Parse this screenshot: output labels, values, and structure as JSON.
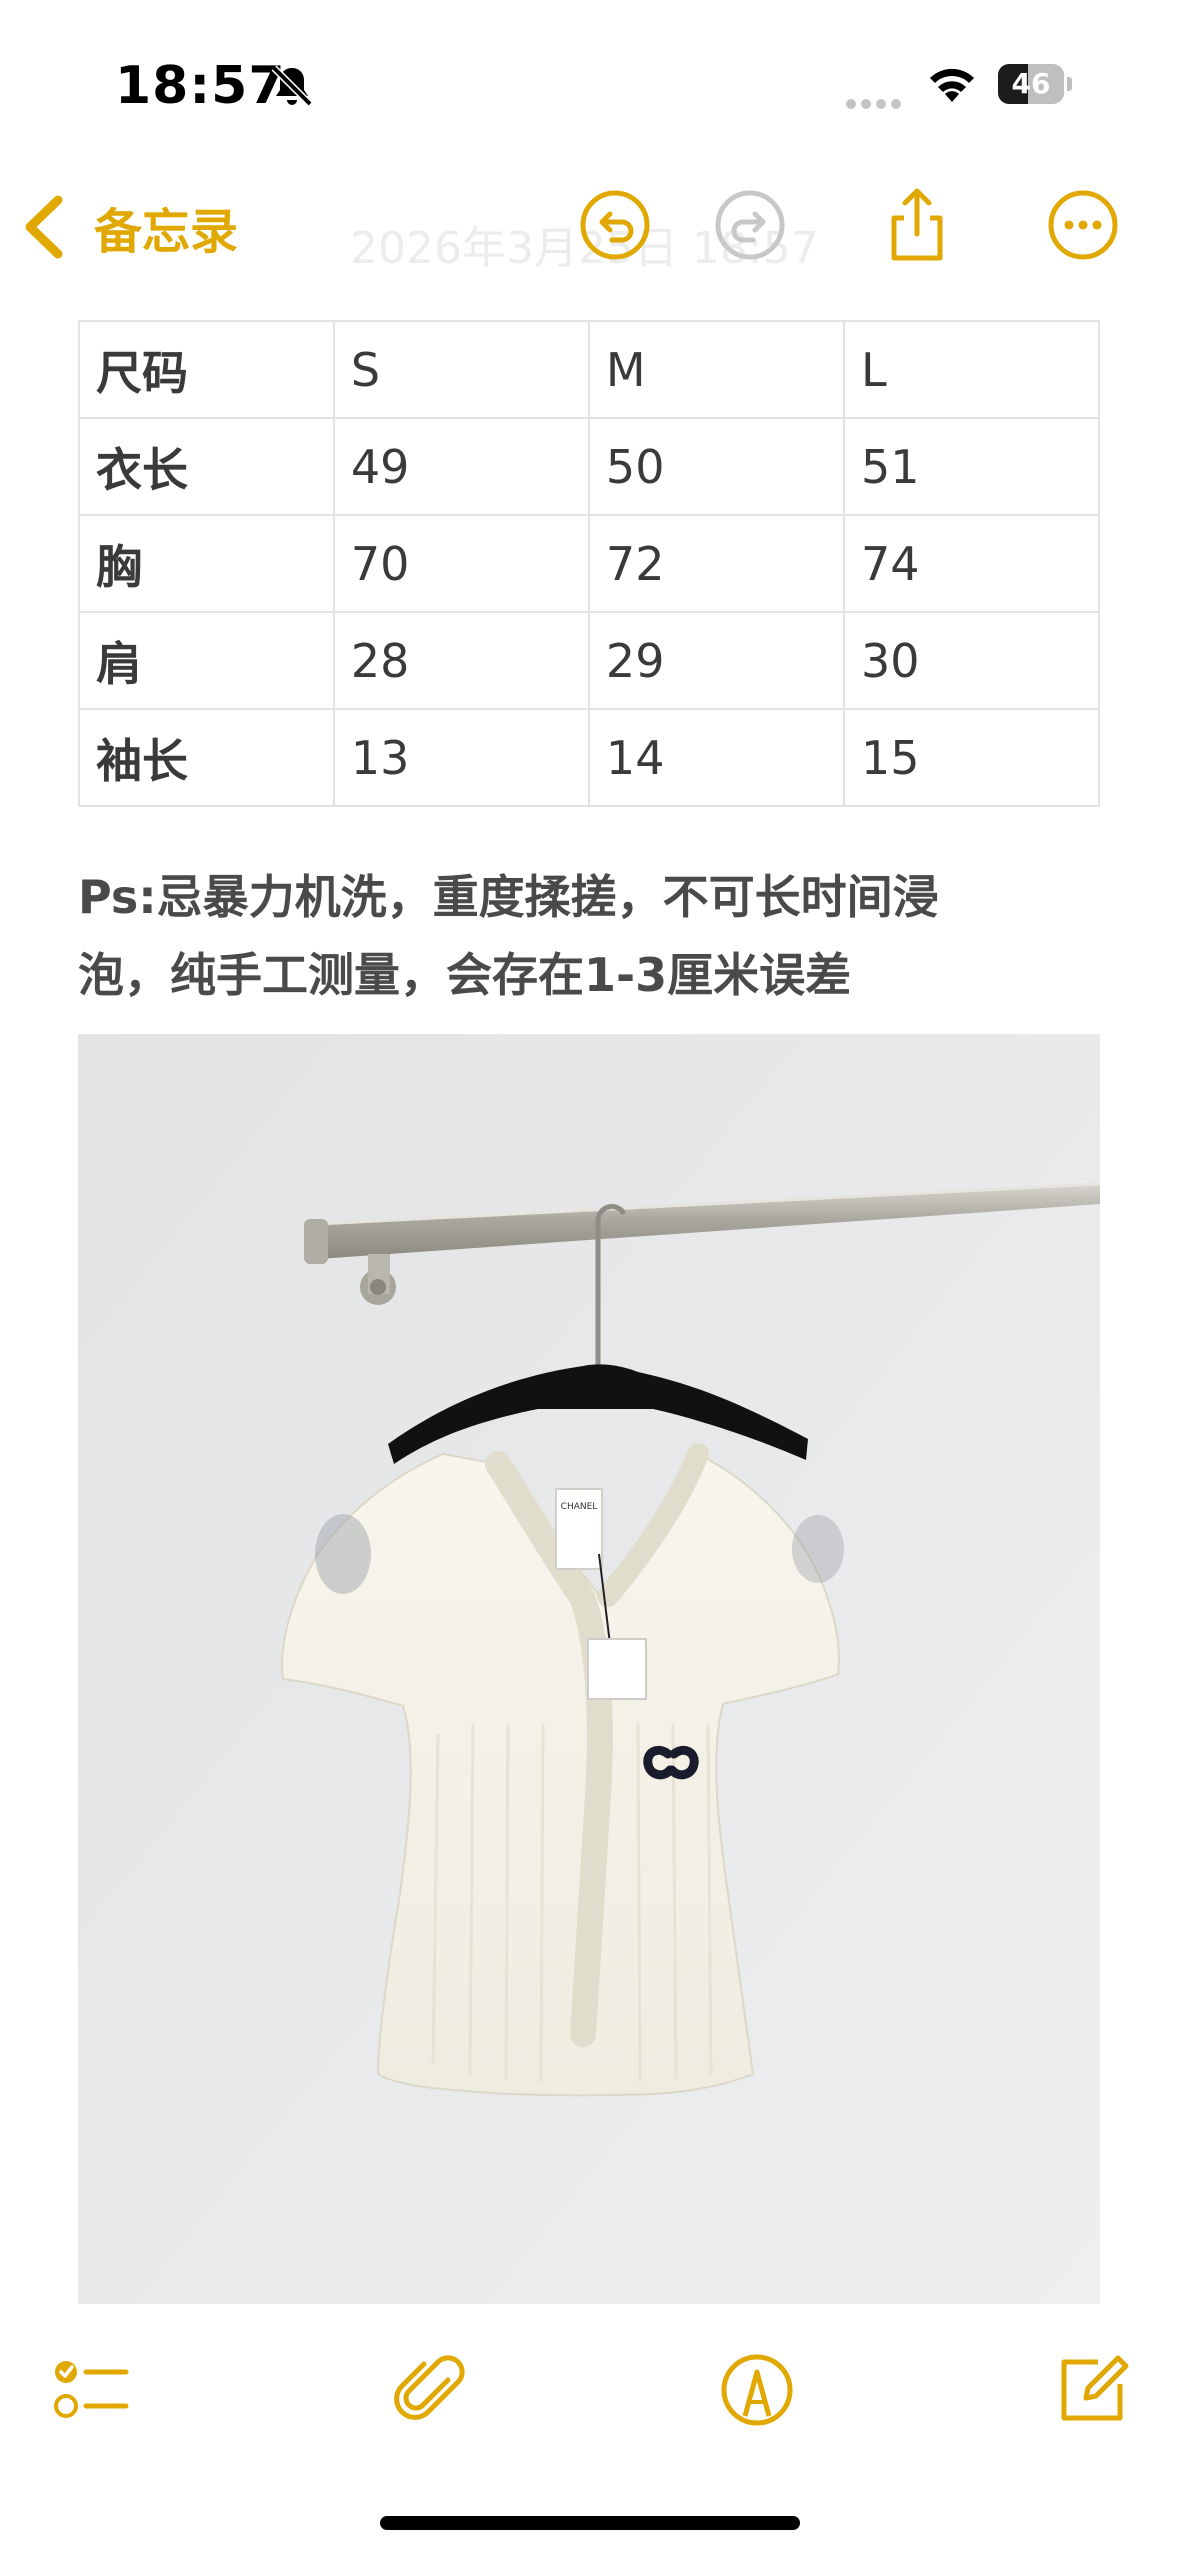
{
  "status_bar": {
    "time": "18:57",
    "battery_level": "46",
    "battery_fraction": 0.46,
    "icons": [
      "bell-slash-icon",
      "cellular-signal-icon",
      "wifi-icon",
      "battery-icon"
    ]
  },
  "nav": {
    "back_label": "备忘录",
    "date_text": "2026年3月25日 18:57",
    "icons": [
      "chevron-left-icon",
      "undo-icon",
      "redo-icon",
      "share-icon",
      "more-icon"
    ]
  },
  "size_table": {
    "header": [
      "尺码",
      "S",
      "M",
      "L"
    ],
    "rows": [
      [
        "衣长",
        "49",
        "50",
        "51"
      ],
      [
        "胸",
        "70",
        "72",
        "74"
      ],
      [
        "肩",
        "28",
        "29",
        "30"
      ],
      [
        "袖长",
        "13",
        "14",
        "15"
      ]
    ]
  },
  "note": {
    "line1": "Ps:忌暴力机洗，重度揉搓，不可长时间浸",
    "line2": "泡，纯手工测量，会存在1-3厘米误差"
  },
  "photo": {
    "label_text": "CHANEL"
  },
  "toolbar": {
    "icons": [
      "checklist-icon",
      "paperclip-icon",
      "markup-pen-icon",
      "compose-icon"
    ]
  },
  "colors": {
    "accent": "#e0a800",
    "text": "#3a3a3a",
    "table_border": "#e3e3e3"
  }
}
